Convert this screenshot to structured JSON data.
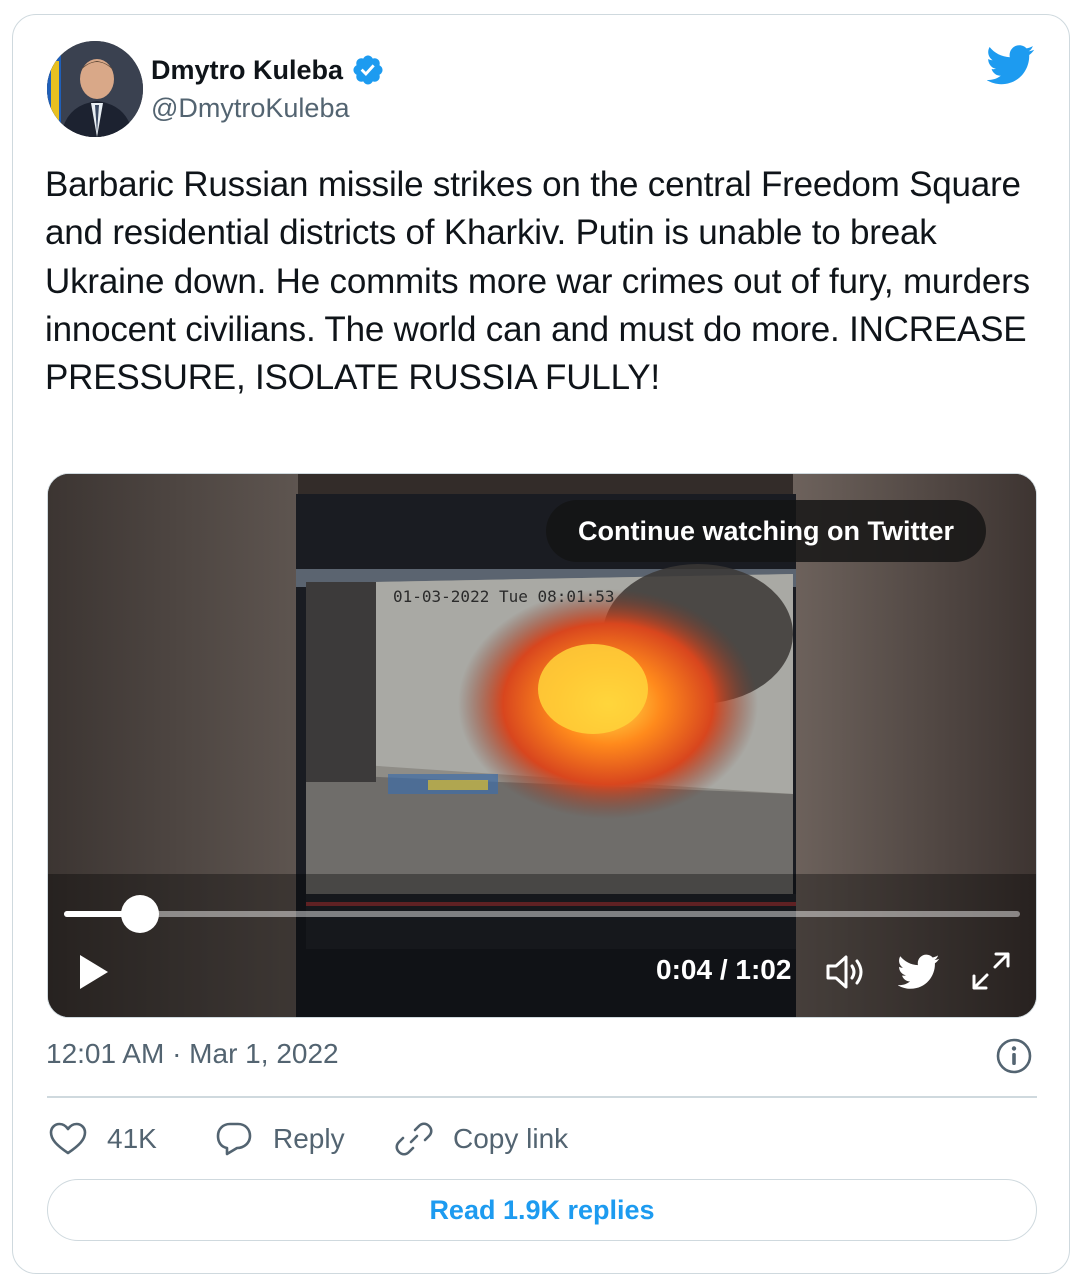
{
  "author": {
    "name": "Dmytro Kuleba",
    "handle": "@DmytroKuleba",
    "verified": true
  },
  "tweet": {
    "text": "Barbaric Russian missile strikes on the central Freedom Square and residential districts of Kharkiv. Putin is unable to break Ukraine down. He commits more war crimes out of fury, murders innocent civilians. The world can and must do more. INCREASE PRESSURE, ISOLATE RUSSIA FULLY!",
    "timestamp": "12:01 AM · Mar 1, 2022"
  },
  "video": {
    "overlay_stamp": "01-03-2022 Tue 08:01:53",
    "cta": "Continue watching on Twitter",
    "time_display": "0:04 / 1:02",
    "progress_fraction": 0.079
  },
  "actions": {
    "likes": "41K",
    "reply": "Reply",
    "copy_link": "Copy link"
  },
  "read_replies": "Read 1.9K replies",
  "colors": {
    "brand": "#1d9bf0",
    "text": "#0f1419",
    "secondary": "#536471",
    "border": "#cfd9de"
  },
  "icons": [
    "verified-badge-icon",
    "twitter-bird-icon",
    "play-icon",
    "volume-icon",
    "expand-icon",
    "info-icon",
    "heart-icon",
    "reply-icon",
    "link-icon"
  ]
}
